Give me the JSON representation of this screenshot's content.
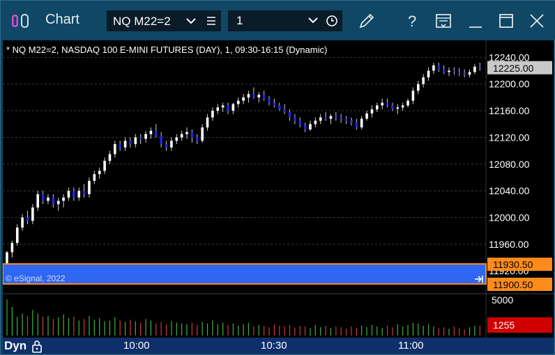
{
  "window": {
    "title": "Chart",
    "symbol": "NQ M22=2",
    "interval": "1",
    "icons": [
      "edit-pen-icon",
      "help-question-icon",
      "layout-icon",
      "minimize-icon",
      "maximize-icon",
      "close-icon"
    ]
  },
  "chart": {
    "header": "* NQ M22=2, NASDAQ 100 E-MINI FUTURES (DAY), 1, 09:30-16:15 (Dynamic)",
    "watermark": "© eSignal, 2022",
    "mode": "Dyn",
    "price_levels": [
      "12240.00",
      "12200.00",
      "12160.00",
      "12120.00",
      "12080.00",
      "12040.00",
      "12000.00",
      "11960.00",
      "11920.00"
    ],
    "current_price": "12225.00",
    "band_top": "11930.50",
    "band_bottom": "11900.50",
    "volume_max": "5000",
    "volume_current": "1255",
    "time_labels": [
      "10:00",
      "10:30",
      "11:00"
    ],
    "colors": {
      "background": "#000000",
      "bull": "#ffffff",
      "bear": "#2222dd",
      "band": "#2f66f2",
      "band_border": "#ff8c1a",
      "vol_up": "#3fb63f",
      "vol_down": "#d43a3a"
    }
  },
  "chart_data": {
    "type": "candlestick",
    "ylim": [
      11890,
      12255
    ],
    "ohlc": [
      [
        11930,
        11950,
        11925,
        11948
      ],
      [
        11948,
        11965,
        11940,
        11962
      ],
      [
        11962,
        11990,
        11958,
        11985
      ],
      [
        11985,
        12005,
        11980,
        12000
      ],
      [
        12000,
        12010,
        11990,
        11995
      ],
      [
        11995,
        12020,
        11990,
        12015
      ],
      [
        12015,
        12040,
        12010,
        12035
      ],
      [
        12035,
        12040,
        12020,
        12025
      ],
      [
        12025,
        12035,
        12020,
        12030
      ],
      [
        12030,
        12035,
        12015,
        12020
      ],
      [
        12020,
        12030,
        12010,
        12025
      ],
      [
        12025,
        12035,
        12015,
        12030
      ],
      [
        12030,
        12045,
        12025,
        12040
      ],
      [
        12040,
        12045,
        12025,
        12030
      ],
      [
        12030,
        12045,
        12025,
        12040
      ],
      [
        12040,
        12050,
        12030,
        12035
      ],
      [
        12035,
        12060,
        12030,
        12055
      ],
      [
        12055,
        12070,
        12050,
        12065
      ],
      [
        12065,
        12075,
        12058,
        12070
      ],
      [
        12070,
        12090,
        12065,
        12085
      ],
      [
        12085,
        12100,
        12080,
        12095
      ],
      [
        12095,
        12115,
        12090,
        12110
      ],
      [
        12110,
        12115,
        12100,
        12105
      ],
      [
        12105,
        12120,
        12100,
        12115
      ],
      [
        12115,
        12120,
        12105,
        12110
      ],
      [
        12110,
        12125,
        12105,
        12120
      ],
      [
        12120,
        12125,
        12110,
        12118
      ],
      [
        12118,
        12130,
        12112,
        12125
      ],
      [
        12125,
        12135,
        12118,
        12130
      ],
      [
        12130,
        12140,
        12120,
        12122
      ],
      [
        12122,
        12128,
        12105,
        12110
      ],
      [
        12110,
        12115,
        12100,
        12105
      ],
      [
        12105,
        12120,
        12100,
        12115
      ],
      [
        12115,
        12125,
        12110,
        12120
      ],
      [
        12120,
        12130,
        12115,
        12125
      ],
      [
        12125,
        12135,
        12118,
        12128
      ],
      [
        12128,
        12132,
        12112,
        12120
      ],
      [
        12120,
        12125,
        12110,
        12115
      ],
      [
        12115,
        12140,
        12112,
        12135
      ],
      [
        12135,
        12155,
        12130,
        12150
      ],
      [
        12150,
        12165,
        12145,
        12160
      ],
      [
        12160,
        12170,
        12155,
        12165
      ],
      [
        12165,
        12172,
        12158,
        12168
      ],
      [
        12168,
        12172,
        12155,
        12160
      ],
      [
        12160,
        12172,
        12155,
        12170
      ],
      [
        12170,
        12180,
        12165,
        12175
      ],
      [
        12175,
        12185,
        12170,
        12180
      ],
      [
        12180,
        12190,
        12172,
        12185
      ],
      [
        12185,
        12195,
        12178,
        12180
      ],
      [
        12180,
        12188,
        12172,
        12184
      ],
      [
        12184,
        12190,
        12175,
        12178
      ],
      [
        12178,
        12182,
        12168,
        12172
      ],
      [
        12172,
        12178,
        12165,
        12168
      ],
      [
        12168,
        12172,
        12160,
        12162
      ],
      [
        12162,
        12170,
        12155,
        12158
      ],
      [
        12158,
        12162,
        12145,
        12150
      ],
      [
        12150,
        12155,
        12140,
        12145
      ],
      [
        12145,
        12150,
        12135,
        12138
      ],
      [
        12138,
        12142,
        12128,
        12132
      ],
      [
        12132,
        12145,
        12130,
        12140
      ],
      [
        12140,
        12150,
        12135,
        12145
      ],
      [
        12145,
        12155,
        12140,
        12150
      ],
      [
        12150,
        12158,
        12145,
        12148
      ],
      [
        12148,
        12155,
        12140,
        12152
      ],
      [
        12152,
        12158,
        12145,
        12150
      ],
      [
        12150,
        12155,
        12142,
        12148
      ],
      [
        12148,
        12152,
        12140,
        12145
      ],
      [
        12145,
        12150,
        12138,
        12142
      ],
      [
        12142,
        12148,
        12132,
        12135
      ],
      [
        12135,
        12152,
        12132,
        12148
      ],
      [
        12148,
        12160,
        12145,
        12156
      ],
      [
        12156,
        12168,
        12150,
        12162
      ],
      [
        12162,
        12172,
        12158,
        12168
      ],
      [
        12168,
        12178,
        12162,
        12172
      ],
      [
        12172,
        12178,
        12165,
        12168
      ],
      [
        12168,
        12172,
        12160,
        12163
      ],
      [
        12163,
        12170,
        12155,
        12165
      ],
      [
        12165,
        12172,
        12160,
        12168
      ],
      [
        12168,
        12178,
        12165,
        12175
      ],
      [
        12175,
        12195,
        12170,
        12190
      ],
      [
        12190,
        12205,
        12185,
        12200
      ],
      [
        12200,
        12215,
        12195,
        12210
      ],
      [
        12210,
        12225,
        12205,
        12220
      ],
      [
        12220,
        12232,
        12215,
        12228
      ],
      [
        12228,
        12232,
        12218,
        12222
      ],
      [
        12222,
        12228,
        12215,
        12218
      ],
      [
        12218,
        12225,
        12212,
        12220
      ],
      [
        12220,
        12225,
        12214,
        12218
      ],
      [
        12218,
        12224,
        12212,
        12216
      ],
      [
        12216,
        12222,
        12210,
        12214
      ],
      [
        12214,
        12222,
        12210,
        12218
      ],
      [
        12218,
        12230,
        12215,
        12226
      ],
      [
        12226,
        12232,
        12220,
        12225
      ]
    ],
    "volume": [
      4800,
      3800,
      2500,
      2900,
      2600,
      3400,
      2900,
      2500,
      2600,
      2200,
      2400,
      2800,
      2300,
      2500,
      2000,
      2200,
      2600,
      2100,
      2300,
      1900,
      2000,
      2400,
      2000,
      1800,
      2100,
      1900,
      1700,
      2200,
      2000,
      1600,
      1800,
      1500,
      1900,
      1700,
      1600,
      1500,
      1700,
      1400,
      1800,
      1600,
      2000,
      1500,
      1700,
      1400,
      1600,
      1300,
      1500,
      1700,
      1200,
      1400,
      1300,
      1100,
      1500,
      1300,
      1200,
      1400,
      1100,
      1300,
      1200,
      1000,
      1400,
      1100,
      1300,
      1000,
      1200,
      1100,
      900,
      1200,
      1000,
      1300,
      1100,
      1400,
      1200,
      1000,
      1300,
      1100,
      1500,
      1200,
      1400,
      1700,
      1600,
      1300,
      1500,
      1200,
      1000,
      1100,
      900,
      1200,
      1000,
      800,
      1100,
      1300,
      1255
    ],
    "volume_up": [
      1,
      1,
      1,
      1,
      0,
      1,
      1,
      0,
      1,
      0,
      1,
      1,
      1,
      0,
      1,
      0,
      1,
      1,
      1,
      1,
      1,
      1,
      0,
      1,
      0,
      1,
      0,
      1,
      1,
      0,
      0,
      0,
      1,
      1,
      1,
      1,
      0,
      0,
      1,
      1,
      1,
      1,
      1,
      0,
      1,
      1,
      1,
      1,
      0,
      1,
      0,
      0,
      0,
      0,
      0,
      0,
      0,
      0,
      0,
      1,
      1,
      1,
      0,
      1,
      0,
      0,
      0,
      0,
      0,
      1,
      1,
      1,
      1,
      1,
      0,
      0,
      1,
      1,
      1,
      1,
      1,
      1,
      1,
      1,
      0,
      0,
      1,
      0,
      0,
      0,
      1,
      1,
      0
    ]
  }
}
